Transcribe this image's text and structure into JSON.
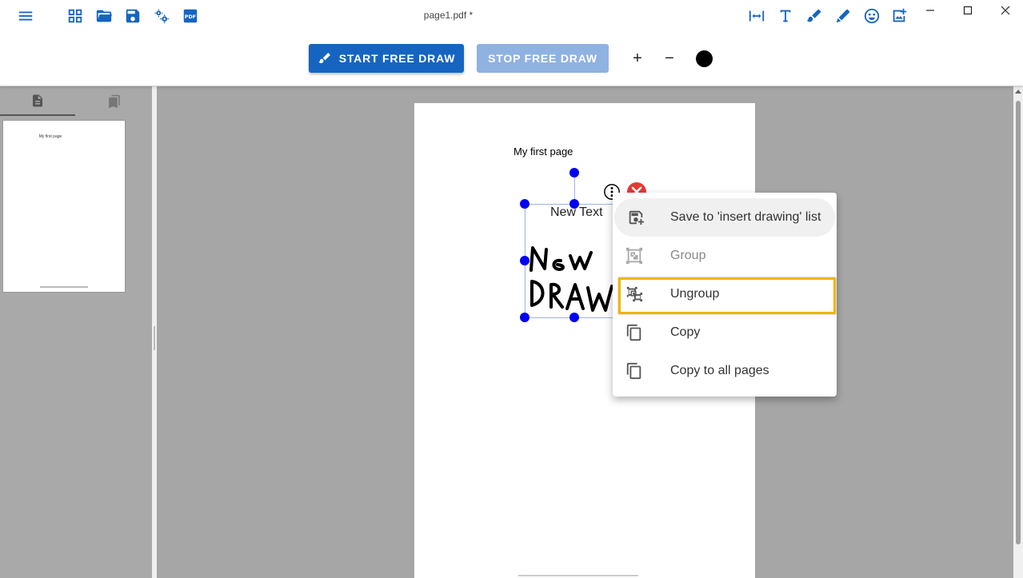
{
  "window": {
    "title": "page1.pdf *"
  },
  "toolbar": {
    "left_icons": [
      "menu-icon",
      "grid-icon",
      "folder-open-icon",
      "save-icon",
      "settings-icon",
      "pdf-icon"
    ],
    "right_icons": [
      "fit-width-icon",
      "text-icon",
      "draw-icon",
      "highlight-icon",
      "emoji-icon",
      "add-image-icon"
    ]
  },
  "drawbar": {
    "start_label": "START FREE DRAW",
    "stop_label": "STOP FREE DRAW",
    "plus_label": "+",
    "minus_label": "−",
    "pen_color": "#000000"
  },
  "sidebar": {
    "tabs": [
      "pages-icon",
      "bookmarks-icon"
    ],
    "thumbnail_title": "My first page"
  },
  "page": {
    "title": "My first page",
    "selection": {
      "text": "New Text"
    }
  },
  "context_menu": {
    "items": [
      {
        "label": "Save to 'insert drawing' list",
        "icon": "save-drawing-icon",
        "disabled": false
      },
      {
        "label": "Group",
        "icon": "group-icon",
        "disabled": true
      },
      {
        "label": "Ungroup",
        "icon": "ungroup-icon",
        "disabled": false
      },
      {
        "label": "Copy",
        "icon": "copy-icon",
        "disabled": false
      },
      {
        "label": "Copy to all pages",
        "icon": "copy-all-icon",
        "disabled": false
      }
    ],
    "highlighted_label": "Ungroup"
  },
  "colors": {
    "accent": "#1565c0",
    "highlight": "#f0b400",
    "handle": "#0000ee",
    "close": "#e53935"
  }
}
